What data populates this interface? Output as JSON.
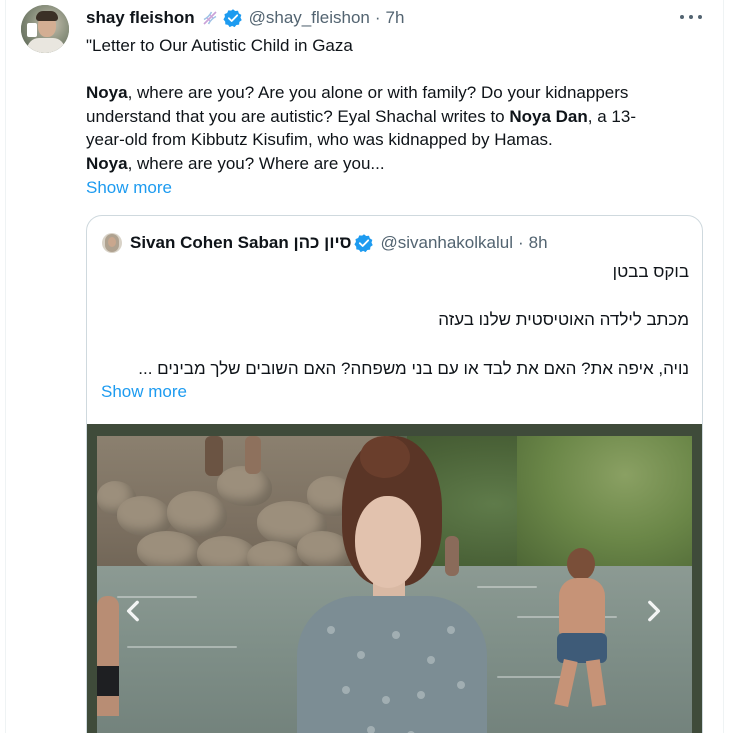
{
  "tweet": {
    "author_name": "shay fleishon",
    "handle": "@shay_fleishon",
    "separator": "·",
    "time": "7h",
    "text": {
      "line1": "\"Letter to Our Autistic Child in Gaza",
      "line2_bold": "Noya",
      "line2_rest": ", where are you? Are you alone or with family? Do your kidnappers",
      "line3_pre": "understand that you are autistic? Eyal Shachal writes to ",
      "line3_bold": "Noya Dan",
      "line3_rest": ", a 13-",
      "line4": "year-old from Kibbutz Kisufim, who was kidnapped by Hamas.",
      "line5_bold": "Noya",
      "line5_rest": ", where are you? Where are you..."
    },
    "show_more": "Show more"
  },
  "quoted_tweet": {
    "author_name": "Sivan Cohen Saban סיון כהן",
    "handle": "@sivanhakolkalul",
    "separator": "·",
    "time": "8h",
    "line1": "בוקס בבטן",
    "line2": "מכתב לילדה האוטיסטית שלנו בעזה",
    "line3": "נויה, איפה את? האם את לבד או עם בני משפחה? האם השובים שלך מבינים ...",
    "show_more": "Show more"
  },
  "colors": {
    "link": "#1d9bf0",
    "verified": "#1d9bf0",
    "secondary_text": "#536471",
    "border": "#cfd9de"
  },
  "icons": {
    "dna": "dna-icon",
    "verified": "verified-badge-icon",
    "more": "more-options-icon",
    "previous": "chevron-left-icon",
    "next": "chevron-right-icon"
  }
}
